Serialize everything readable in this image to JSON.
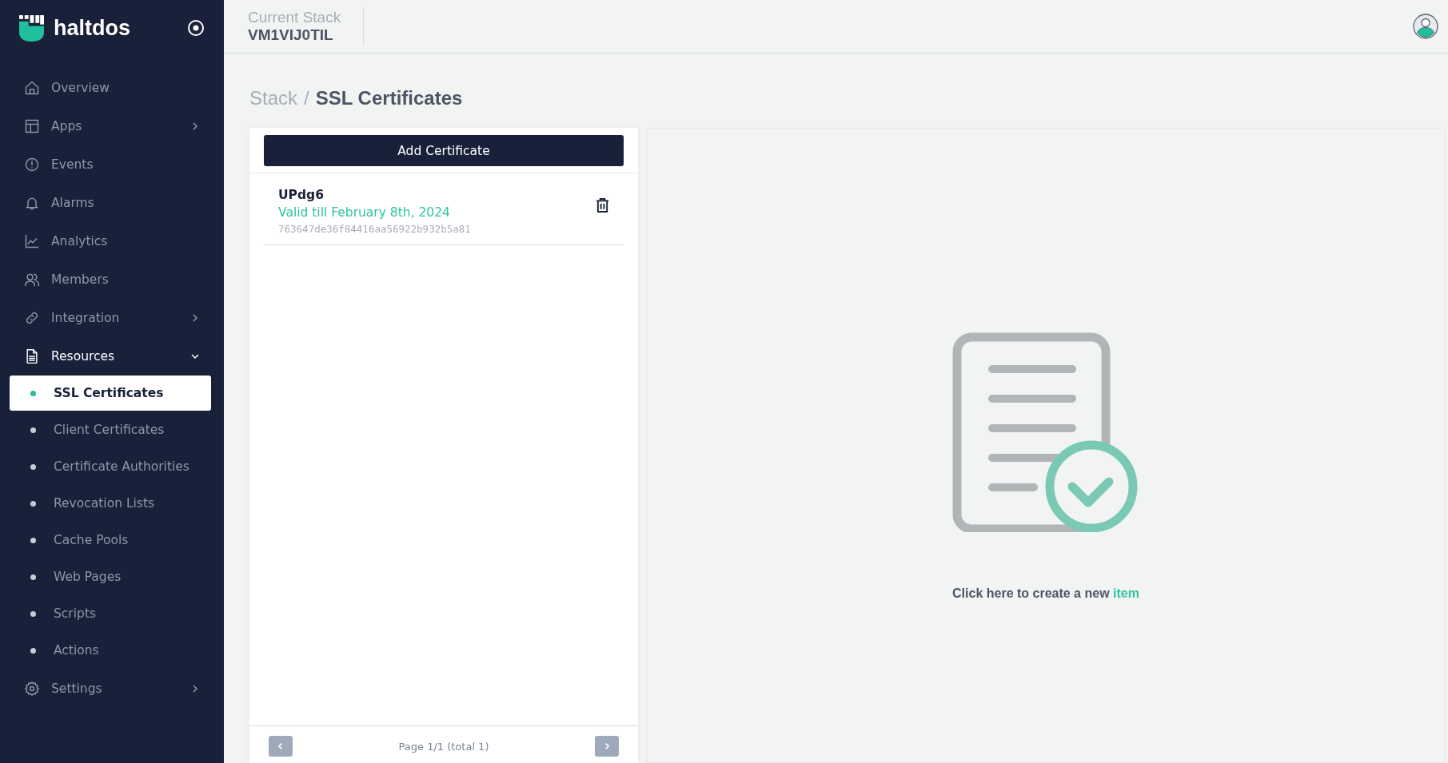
{
  "brand": {
    "name": "haltdos"
  },
  "header": {
    "label": "Current Stack",
    "value": "VM1VIJ0TIL"
  },
  "sidebar": {
    "items": [
      {
        "kind": "main",
        "label": "Overview"
      },
      {
        "kind": "main",
        "label": "Apps",
        "expanded": false
      },
      {
        "kind": "main",
        "label": "Events"
      },
      {
        "kind": "main",
        "label": "Alarms"
      },
      {
        "kind": "main",
        "label": "Analytics"
      },
      {
        "kind": "main",
        "label": "Members"
      },
      {
        "kind": "main",
        "label": "Integration",
        "expanded": false
      },
      {
        "kind": "main",
        "label": "Resources",
        "expanded": true
      },
      {
        "kind": "sub",
        "label": "SSL Certificates",
        "selected": true
      },
      {
        "kind": "sub",
        "label": "Client Certificates",
        "selected": false
      },
      {
        "kind": "sub",
        "label": "Certificate Authorities",
        "selected": false
      },
      {
        "kind": "sub",
        "label": "Revocation Lists",
        "selected": false
      },
      {
        "kind": "sub",
        "label": "Cache Pools",
        "selected": false
      },
      {
        "kind": "sub",
        "label": "Web Pages",
        "selected": false
      },
      {
        "kind": "sub",
        "label": "Scripts",
        "selected": false
      },
      {
        "kind": "sub",
        "label": "Actions",
        "selected": false
      },
      {
        "kind": "main",
        "label": "Settings",
        "expanded": false
      }
    ]
  },
  "breadcrumb": {
    "parent": "Stack",
    "separator": "/",
    "current": "SSL Certificates"
  },
  "list": {
    "add_button": "Add Certificate",
    "items": [
      {
        "name": "UPdg6",
        "validity": "Valid till February 8th, 2024",
        "fingerprint": "763647de36f84416aa56922b932b5a81"
      }
    ],
    "pagination": "Page 1/1 (total 1)"
  },
  "empty_state": {
    "text": "Click here to create a new",
    "link": "item"
  }
}
